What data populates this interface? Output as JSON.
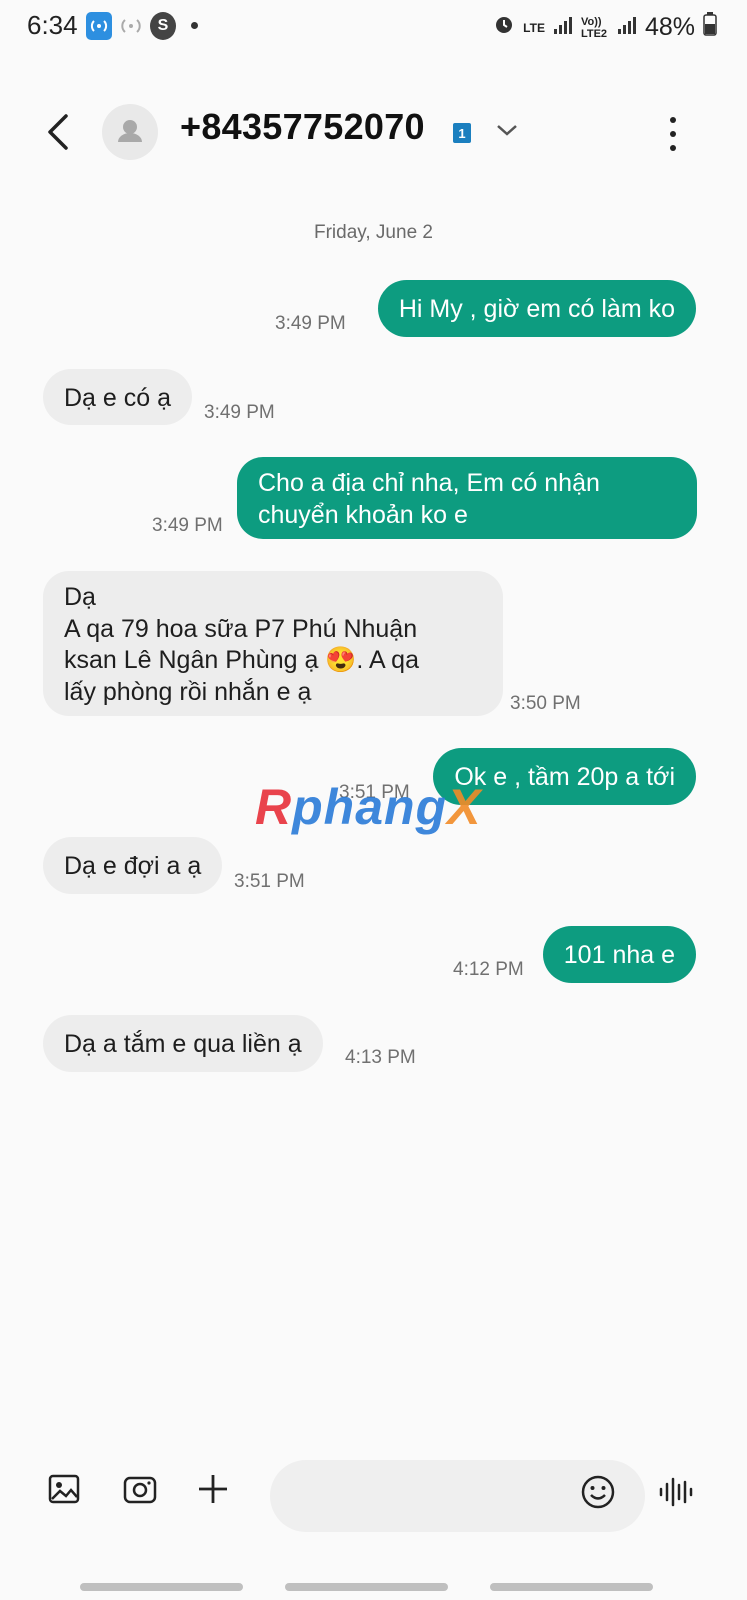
{
  "status_bar": {
    "time": "6:34",
    "battery_percent": "48%",
    "network_1": "LTE",
    "network_2": "Vo)) LTE2"
  },
  "header": {
    "contact": "+84357752070",
    "sim_badge": "1"
  },
  "conversation": {
    "date": "Friday, June 2",
    "messages": [
      {
        "direction": "outgoing",
        "text": "Hi My , giờ em có làm ko",
        "time": "3:49 PM"
      },
      {
        "direction": "incoming",
        "text": "Dạ e có ạ",
        "time": "3:49 PM"
      },
      {
        "direction": "outgoing",
        "text": "Cho a địa chỉ nha, Em có nhận\nchuyển khoản ko e",
        "time": "3:49 PM"
      },
      {
        "direction": "incoming",
        "text": "Dạ\nA qa 79 hoa sữa P7 Phú Nhuận\nksan Lê Ngân Phùng ạ 😍. A qa\nlấy phòng rồi nhắn e ạ",
        "time": "3:50 PM"
      },
      {
        "direction": "outgoing",
        "text": "Ok e , tầm 20p a tới",
        "time": "3:51 PM"
      },
      {
        "direction": "incoming",
        "text": "Dạ e đợi a ạ",
        "time": "3:51 PM"
      },
      {
        "direction": "outgoing",
        "text": "101 nha e",
        "time": "4:12 PM"
      },
      {
        "direction": "incoming",
        "text": "Dạ a tắm e qua liền ạ",
        "time": "4:13 PM"
      }
    ]
  },
  "watermark": {
    "part1": "R",
    "part2": "phang",
    "part3": "X"
  },
  "colors": {
    "outgoing_bubble": "#0d9c80",
    "incoming_bubble": "#ededed",
    "background": "#fafafa"
  },
  "icons": [
    "back-arrow-icon",
    "contact-avatar-icon",
    "chevron-down-icon",
    "more-options-icon",
    "gallery-icon",
    "camera-icon",
    "plus-icon",
    "emoji-icon",
    "voice-icon"
  ]
}
